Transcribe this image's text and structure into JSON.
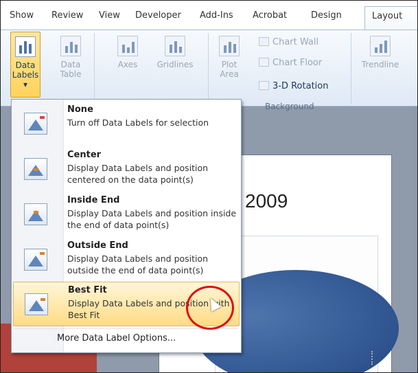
{
  "tabs": [
    "Show",
    "Review",
    "View",
    "Developer",
    "Add-Ins",
    "Acrobat",
    "Design",
    "Layout"
  ],
  "ribbon": {
    "data_labels": "Data Labels",
    "data_labels_arrow": "▾",
    "data_table_line1": "Data",
    "data_table_line2": "Table",
    "axes": "Axes",
    "gridlines": "Gridlines",
    "plot_area_line1": "Plot",
    "plot_area_line2": "Area",
    "chart_wall": "Chart Wall",
    "chart_floor": "Chart Floor",
    "rotation": "3-D Rotation",
    "background_group": "Background",
    "trendline": "Trendline"
  },
  "chart": {
    "title_fragment": "2009"
  },
  "menu": {
    "items": [
      {
        "title": "None",
        "description": "Turn off Data Labels for selection",
        "highlighted": false
      },
      {
        "title": "Center",
        "description": "Display Data Labels and position centered on the data point(s)",
        "highlighted": false
      },
      {
        "title": "Inside End",
        "description": "Display Data Labels and position inside the end of data point(s)",
        "highlighted": false
      },
      {
        "title": "Outside End",
        "description": "Display Data Labels and position outside the end of data point(s)",
        "highlighted": false
      },
      {
        "title": "Best Fit",
        "description": "Display Data Labels and position with Best Fit",
        "highlighted": true
      }
    ],
    "more_options": "More Data Label Options..."
  },
  "colors": {
    "highlight": "#ffdc84",
    "annotation_circle": "#e10c0c",
    "pie_blue": "#2f5490",
    "pie_red": "#b1423b"
  }
}
